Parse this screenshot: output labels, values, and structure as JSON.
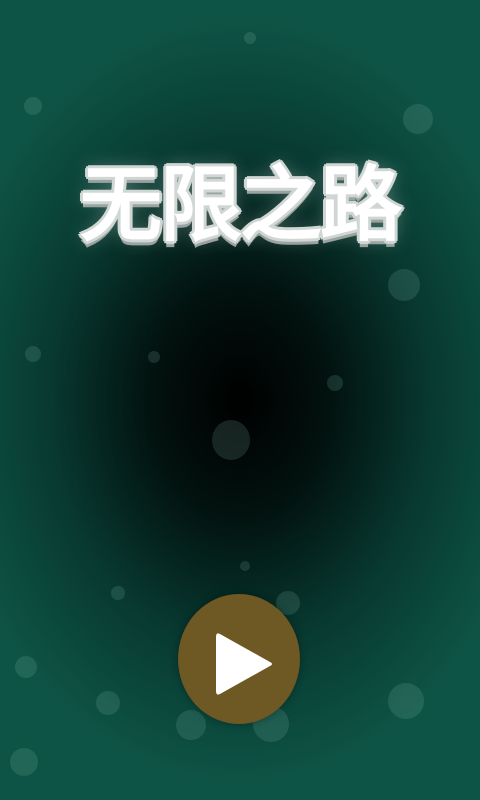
{
  "title": "无限之路",
  "play_button": {
    "icon": "play-icon",
    "color": "#6e5823"
  },
  "colors": {
    "background_edge": "#0e5446",
    "background_center": "#000000",
    "title_text": "#ffffff"
  }
}
